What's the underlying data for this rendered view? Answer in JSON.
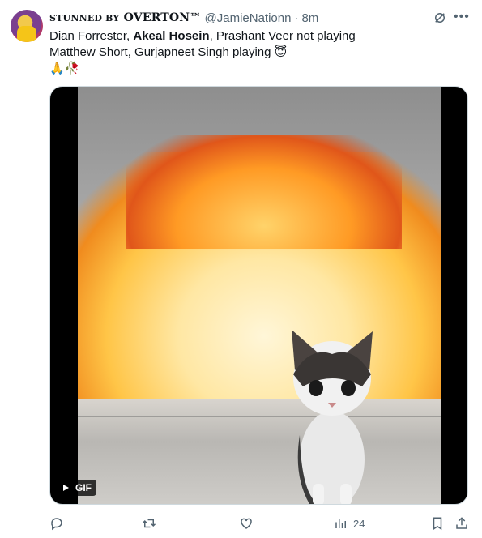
{
  "author": {
    "display_name_prefix": "STUNNED BY",
    "display_name": "OVERTON™",
    "handle": "@JamieNationn",
    "time": "8m"
  },
  "tweet": {
    "line1_part1": "Dian Forrester, ",
    "line1_bold": "Akeal Hosein",
    "line1_part2": ", Prashant Veer not playing",
    "line2": "Matthew Short, Gurjapneet Singh playing",
    "line2_emoji": "😇",
    "line3": "🙏🥀"
  },
  "media": {
    "badge": "GIF"
  },
  "actions": {
    "views": "24"
  },
  "colors": {
    "text": "#0f1419",
    "secondary": "#536471",
    "border": "#cfd9de"
  },
  "icons": [
    "grok-icon",
    "more-icon",
    "reply-icon",
    "retweet-icon",
    "like-icon",
    "views-icon",
    "bookmark-icon",
    "share-icon",
    "play-icon"
  ]
}
